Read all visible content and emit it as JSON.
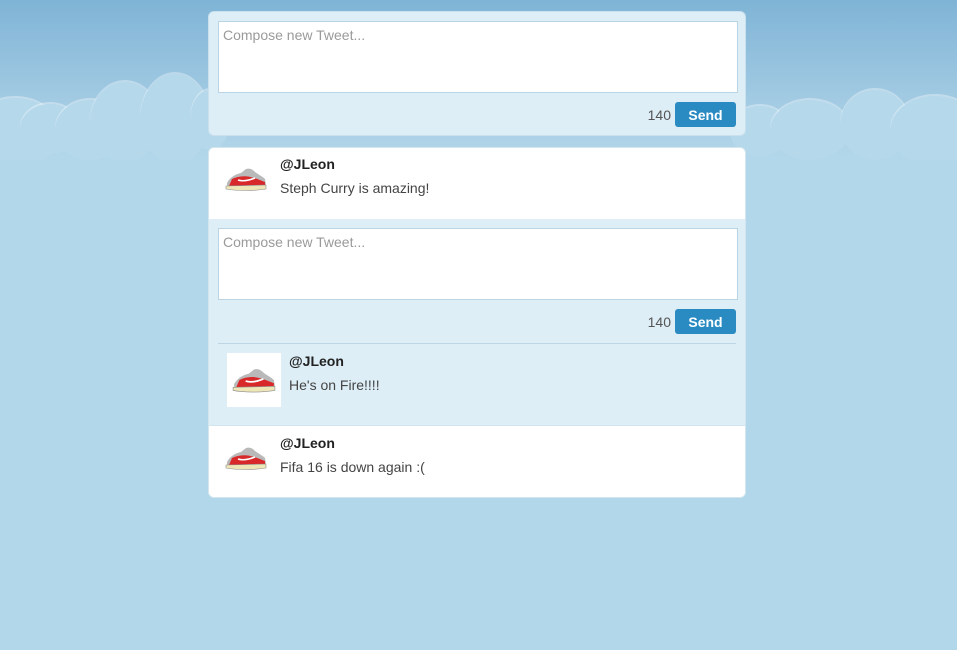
{
  "compose": {
    "placeholder": "Compose new Tweet...",
    "count": "140",
    "send_label": "Send"
  },
  "feed": {
    "tweets": [
      {
        "handle": "@JLeon",
        "text": "Steph Curry is amazing!",
        "avatar_icon": "sneaker-icon"
      },
      {
        "handle": "@JLeon",
        "text": "Fifa 16 is down again :(",
        "avatar_icon": "sneaker-icon"
      }
    ],
    "reply_compose": {
      "placeholder": "Compose new Tweet...",
      "count": "140",
      "send_label": "Send"
    },
    "reply": {
      "handle": "@JLeon",
      "text": "He's on Fire!!!!",
      "avatar_icon": "sneaker-icon"
    }
  },
  "colors": {
    "accent": "#2a8bc2",
    "background": "#b3d7ea",
    "panel": "#ddeef6"
  }
}
